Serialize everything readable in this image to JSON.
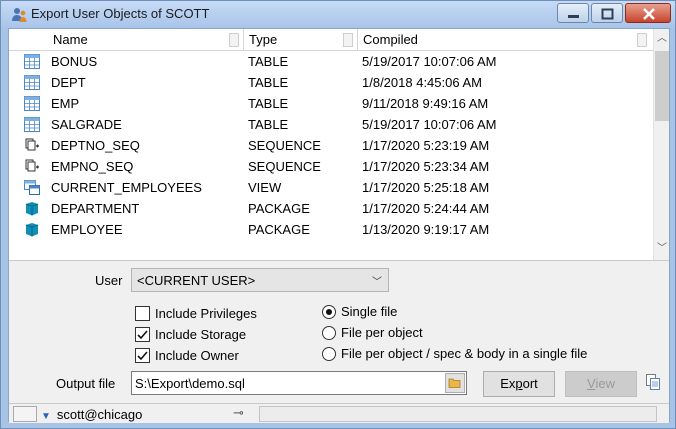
{
  "window": {
    "title": "Export User Objects of SCOTT",
    "colors": {
      "titlebar": "#a9c5ea",
      "close": "#c7442d"
    }
  },
  "grid": {
    "columns": [
      "Name",
      "Type",
      "Compiled"
    ],
    "rows": [
      {
        "icon": "table-icon",
        "name": "BONUS",
        "type": "TABLE",
        "compiled": "5/19/2017 10:07:06 AM"
      },
      {
        "icon": "table-icon",
        "name": "DEPT",
        "type": "TABLE",
        "compiled": "1/8/2018 4:45:06 AM"
      },
      {
        "icon": "table-icon",
        "name": "EMP",
        "type": "TABLE",
        "compiled": "9/11/2018 9:49:16 AM"
      },
      {
        "icon": "table-icon",
        "name": "SALGRADE",
        "type": "TABLE",
        "compiled": "5/19/2017 10:07:06 AM"
      },
      {
        "icon": "sequence-icon",
        "name": "DEPTNO_SEQ",
        "type": "SEQUENCE",
        "compiled": "1/17/2020 5:23:19 AM"
      },
      {
        "icon": "sequence-icon",
        "name": "EMPNO_SEQ",
        "type": "SEQUENCE",
        "compiled": "1/17/2020 5:23:34 AM"
      },
      {
        "icon": "view-icon",
        "name": "CURRENT_EMPLOYEES",
        "type": "VIEW",
        "compiled": "1/17/2020 5:25:18 AM"
      },
      {
        "icon": "package-icon",
        "name": "DEPARTMENT",
        "type": "PACKAGE",
        "compiled": "1/17/2020 5:24:44 AM"
      },
      {
        "icon": "package-icon",
        "name": "EMPLOYEE",
        "type": "PACKAGE",
        "compiled": "1/13/2020 9:19:17 AM"
      }
    ]
  },
  "options": {
    "user_label": "User",
    "user_value": "<CURRENT USER>",
    "checkboxes": [
      {
        "label": "Include Privileges",
        "checked": false
      },
      {
        "label": "Include Storage",
        "checked": true
      },
      {
        "label": "Include Owner",
        "checked": true
      }
    ],
    "radios": [
      {
        "label": "Single file",
        "selected": true
      },
      {
        "label": "File per object",
        "selected": false
      },
      {
        "label": "File per object / spec & body in a single file",
        "selected": false
      }
    ],
    "output_label": "Output file",
    "output_value": "S:\\Export\\demo.sql",
    "export_label": "Export",
    "view_label": "View"
  },
  "status": {
    "connection": "scott@chicago"
  }
}
